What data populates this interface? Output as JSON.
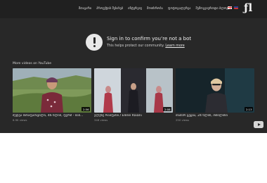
{
  "header": {
    "nav": [
      "მთავარი",
      "პროექტის შესახებ",
      "ინტერვიუ",
      "მოთხრობა",
      "ფოტოგალერეა",
      "შემოგვიერთდი ბლოგი"
    ],
    "flags": [
      "geo-flag-icon",
      "english-flag-icon"
    ],
    "logo_text": "ƒl"
  },
  "player": {
    "alert_icon": "alert-circle-icon",
    "title": "Sign in to confirm you’re not a bot",
    "subtitle": "This helps protect our community.",
    "learn_more": "Learn more",
    "more_videos_label": "More videos on YouTube",
    "videos": [
      {
        "title": "მედეა მანაფაძავილი, 46 წლის, ფერმ - ბაბ...",
        "views": "6.9K views",
        "duration": "2:56"
      },
      {
        "title": "ელენე რაიფანი / Elene Raiani",
        "views": "346 views",
        "duration": "2:08"
      },
      {
        "title": "თამარ ცეცია, 24 წლის, თბილისი",
        "views": "250 views",
        "duration": "2:13"
      }
    ],
    "youtube_badge": "youtube-logo-icon"
  },
  "colors": {
    "topbar": "#202020",
    "player_bg": "#282828",
    "text_light": "#f1f1f1"
  }
}
